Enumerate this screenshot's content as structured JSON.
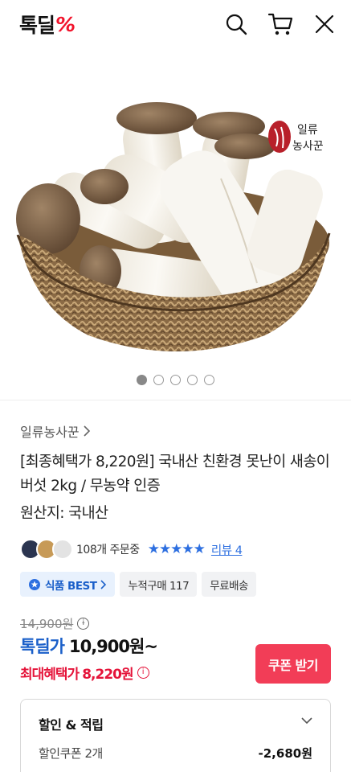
{
  "header": {
    "logo_text": "톡딜",
    "logo_mark": "%",
    "icons": [
      "search-icon",
      "cart-icon",
      "close-icon"
    ]
  },
  "gallery": {
    "brand_stamp_line1": "일류",
    "brand_stamp_line2": "농사꾼",
    "dot_count": 5,
    "active_index": 0
  },
  "product": {
    "seller": "일류농사꾼",
    "title": "[최종혜택가 8,220원] 국내산 친환경 못난이 새송이 버섯 2kg / 무농약 인증",
    "origin": "원산지: 국내산",
    "order_count": "108개 주문중",
    "stars": "★★★★★",
    "review_link": "리뷰 4",
    "badges": {
      "best": "식품 BEST",
      "purchases": "누적구매 117",
      "shipping": "무료배송"
    }
  },
  "price": {
    "original": "14,900원",
    "deal_label": "톡딜가",
    "deal_price": "10,900원~",
    "max_label": "최대혜택가",
    "max_price": "8,220원",
    "coupon_button": "쿠폰 받기"
  },
  "benefits": {
    "title": "할인 & 적립",
    "coupon_label": "할인쿠폰 2개",
    "coupon_value": "-2,680원"
  },
  "colors": {
    "brand_red": "#f2142c",
    "deal_blue": "#1a5fc9",
    "benefit_red": "#e5143a",
    "coupon_button": "#f23d57"
  }
}
